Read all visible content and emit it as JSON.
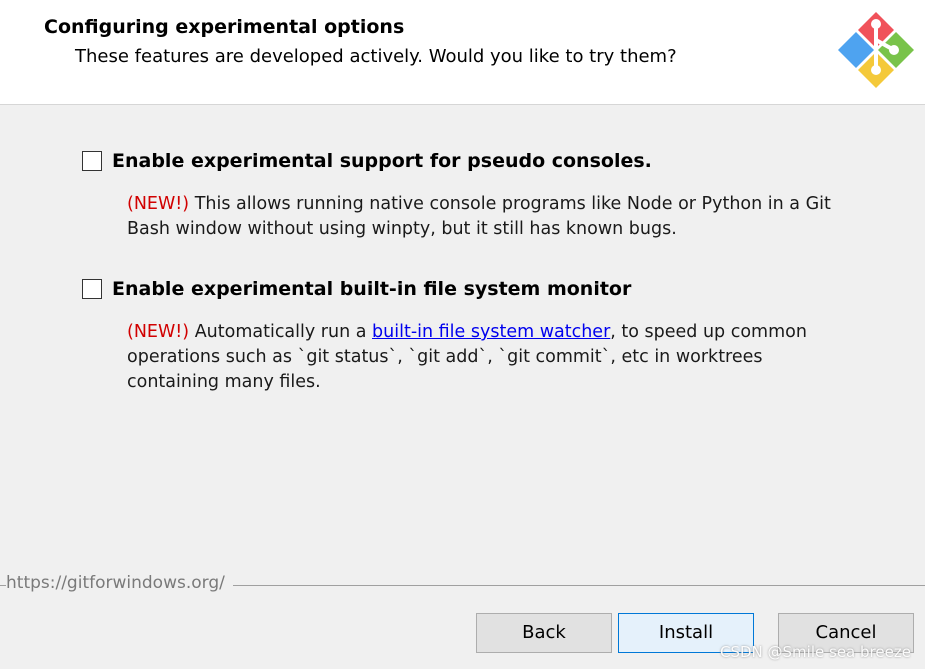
{
  "header": {
    "title": "Configuring experimental options",
    "subtitle": "These features are developed actively. Would you like to try them?"
  },
  "logo": {
    "icon": "git-logo-icon",
    "colors": {
      "red": "#f0525a",
      "green": "#79c34a",
      "blue": "#4ea3f0",
      "yellow": "#f4c93a"
    }
  },
  "options": [
    {
      "checked": false,
      "label": "Enable experimental support for pseudo consoles.",
      "new_tag": "(NEW!)",
      "description": " This allows running native console programs like Node or Python in a Git Bash window without using winpty, but it still has known bugs."
    },
    {
      "checked": false,
      "label": "Enable experimental built-in file system monitor",
      "new_tag": "(NEW!)",
      "description_before": " Automatically run a ",
      "link_text": "built-in file system watcher",
      "description_after": ", to speed up common operations such as `git status`, `git add`, `git commit`, etc in worktrees containing many files."
    }
  ],
  "footer": {
    "url": "https://gitforwindows.org/"
  },
  "buttons": {
    "back": "Back",
    "install": "Install",
    "cancel": "Cancel"
  },
  "watermark": "CSDN @Smile sea breeze"
}
